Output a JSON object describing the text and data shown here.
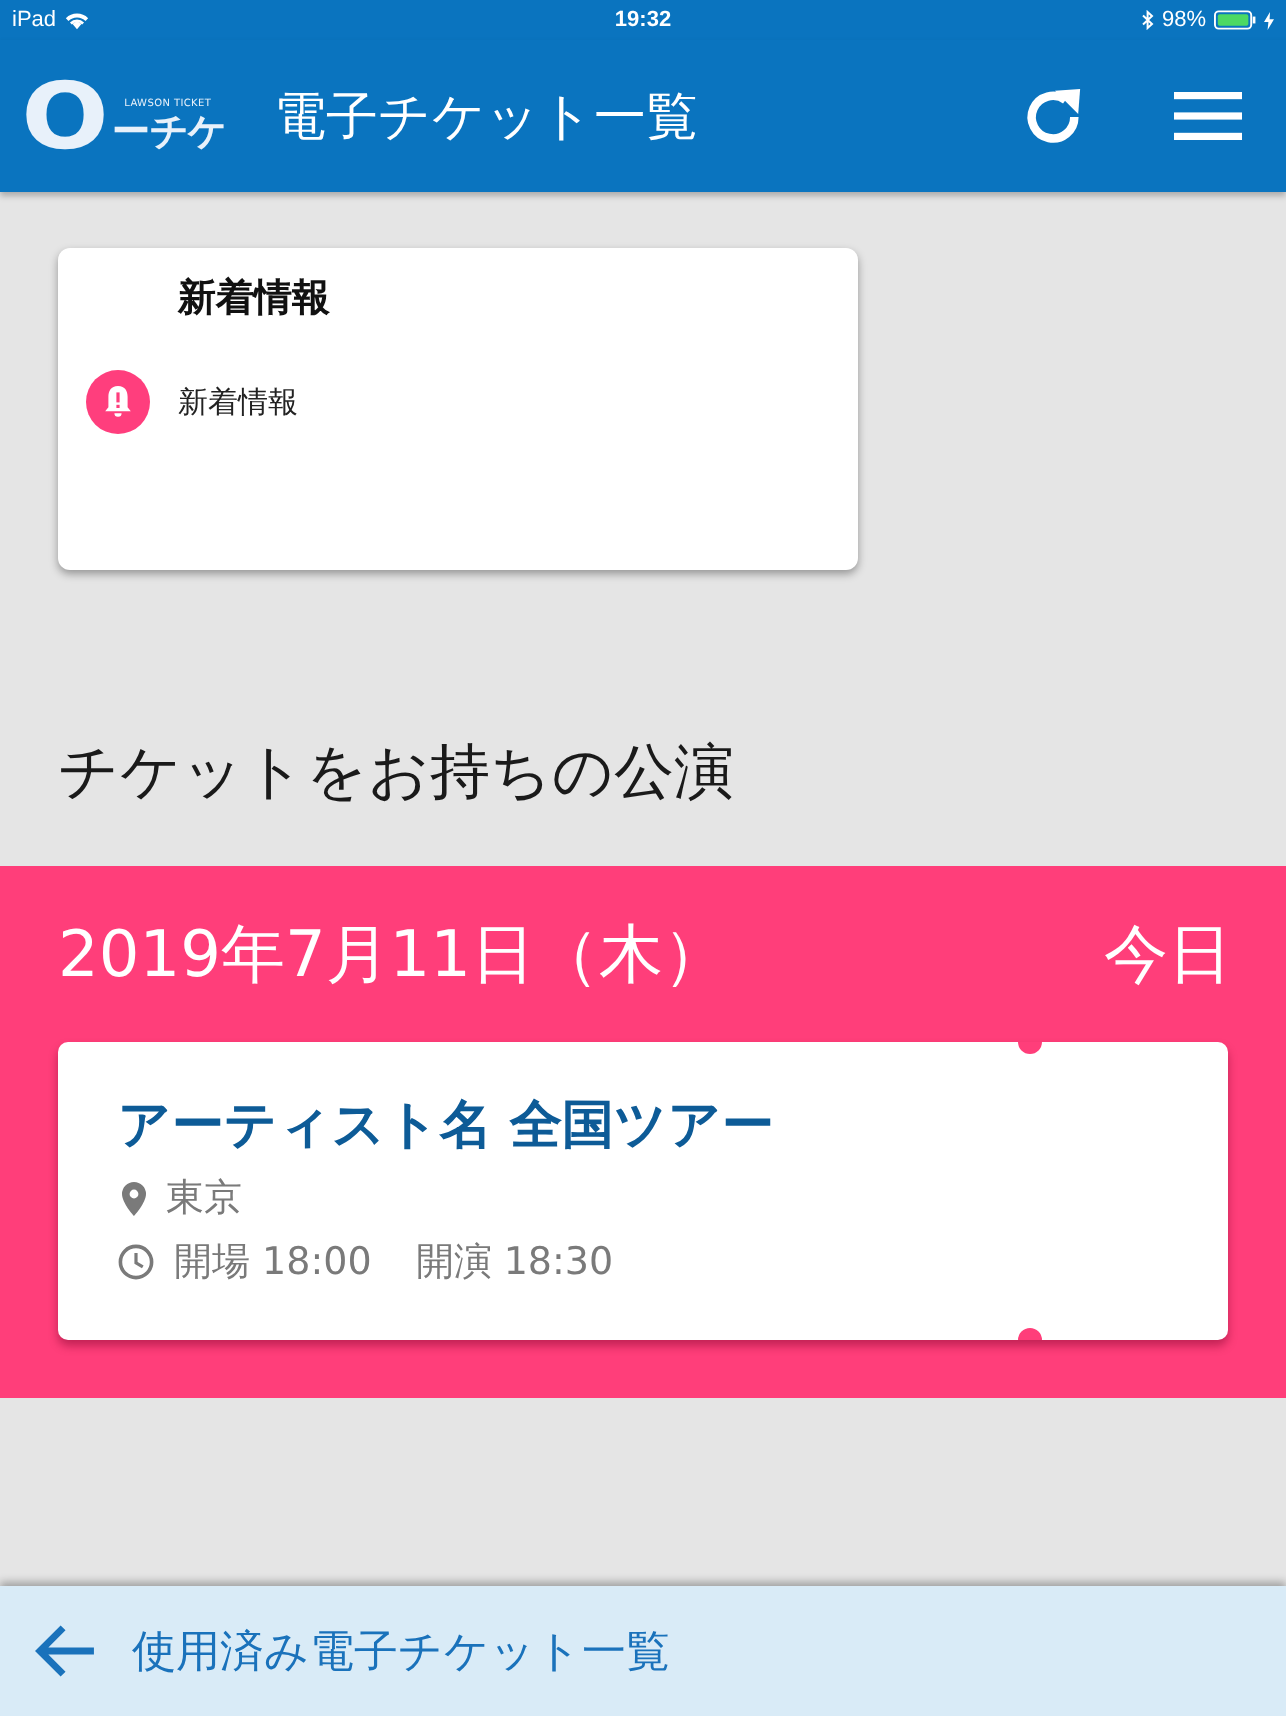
{
  "status_bar": {
    "device": "iPad",
    "time": "19:32",
    "battery": "98%"
  },
  "header": {
    "logo": {
      "tagline": "LAWSON TICKET",
      "mark": "O",
      "name": "ーチケ"
    },
    "title": "電子チケット一覧"
  },
  "news_card": {
    "title": "新着情報",
    "items": [
      {
        "label": "新着情報"
      }
    ]
  },
  "section_heading": "チケットをお持ちの公演",
  "event_days": [
    {
      "date": "2019年7月11日（木）",
      "badge": "今日",
      "tickets": [
        {
          "title": "アーティスト名 全国ツアー",
          "venue": "東京",
          "open_time": "開場 18:00",
          "start_time": "開演 18:30"
        }
      ]
    }
  ],
  "footer": {
    "link": "使用済み電子チケット一覧"
  }
}
